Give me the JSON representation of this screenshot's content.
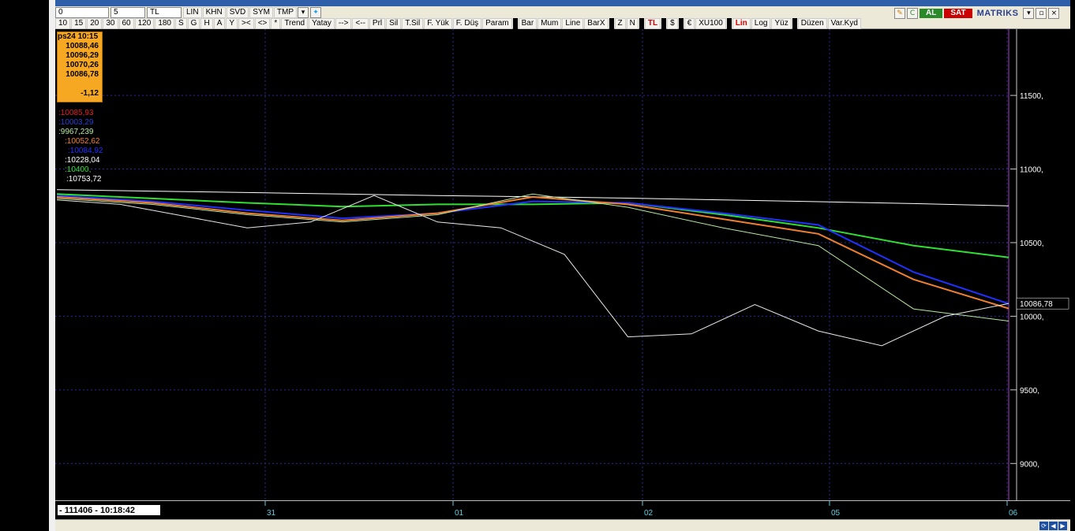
{
  "toolbar": {
    "row1": {
      "field0": "0",
      "period": "5",
      "currency": "TL",
      "buttons": [
        "LIN",
        "KHN",
        "SVD",
        "SYM",
        "TMP"
      ],
      "right_logo": "MATRIKS",
      "buy_label": "AL",
      "sell_label": "SAT"
    },
    "row2": {
      "periods": [
        "10",
        "15",
        "20",
        "30",
        "60",
        "120",
        "180",
        "S",
        "G",
        "H",
        "A",
        "Y"
      ],
      "tools": [
        "><",
        "<>",
        "*",
        "Trend",
        "Yatay",
        "-->",
        "<--",
        "Prl",
        "Sil",
        "T.Sil",
        "F. Yük",
        "F. Düş",
        "Param",
        "Bar",
        "Mum",
        "Line",
        "BarX",
        "Z",
        "N",
        "TL",
        "$",
        "€",
        "XU100",
        "Lin",
        "Log",
        "Yüz",
        "Düzen",
        "Var.Kyd"
      ]
    }
  },
  "infobox": {
    "head": "ps24 10:15",
    "open": "10088,46",
    "high": "10096,29",
    "low": "10070,26",
    "close": "10086,78",
    "change": "-1,12"
  },
  "legend": [
    {
      "text": ":10085,93",
      "color": "#e02020"
    },
    {
      "text": ":10003,29",
      "color": "#2a3fd0"
    },
    {
      "text": ":9967,239",
      "color": "#b8e8a0"
    },
    {
      "text": ":10052,62",
      "color": "#f08030"
    },
    {
      "text": ":10084,92",
      "color": "#2030ff"
    },
    {
      "text": ":10228,04",
      "color": "#ffffff"
    },
    {
      "text": ":10400,",
      "color": "#30e030"
    },
    {
      "text": ":10753,72",
      "color": "#ffffff"
    }
  ],
  "status": {
    "text": "- 111406 - 10:18:42"
  },
  "chart_data": {
    "type": "line",
    "y_axis_ticks": [
      "11500,",
      "11000,",
      "10500,",
      "10000,",
      "9500,",
      "9000,"
    ],
    "ylim": [
      8750,
      11950
    ],
    "x_labels": [
      "31",
      "01",
      "02",
      "05",
      "06"
    ],
    "last_price_label": "10086,78",
    "last_price": 10086.78,
    "grid": true,
    "series": [
      {
        "color": "#ffffff",
        "values": [
          10860,
          10850,
          10840,
          10830,
          10820,
          10812,
          10802,
          10790,
          10778,
          10765,
          10750
        ]
      },
      {
        "color": "#30e030",
        "values": [
          10830,
          10800,
          10770,
          10745,
          10760,
          10760,
          10770,
          10690,
          10600,
          10480,
          10400
        ]
      },
      {
        "color": "#2030ff",
        "values": [
          10820,
          10780,
          10720,
          10665,
          10700,
          10780,
          10770,
          10700,
          10620,
          10300,
          10084.92
        ]
      },
      {
        "color": "#f08030",
        "values": [
          10810,
          10770,
          10700,
          10650,
          10700,
          10810,
          10760,
          10660,
          10560,
          10250,
          10052.62
        ]
      },
      {
        "color": "#b8e8a0",
        "values": [
          10800,
          10760,
          10690,
          10640,
          10690,
          10830,
          10740,
          10600,
          10480,
          10050,
          9967.24
        ]
      },
      {
        "color": "#e8e8e8",
        "values": [
          10790,
          10760,
          10680,
          10600,
          10640,
          10820,
          10640,
          10600,
          10420,
          9860,
          9880,
          10080,
          9900,
          9800,
          10000,
          10086.78
        ]
      }
    ]
  }
}
